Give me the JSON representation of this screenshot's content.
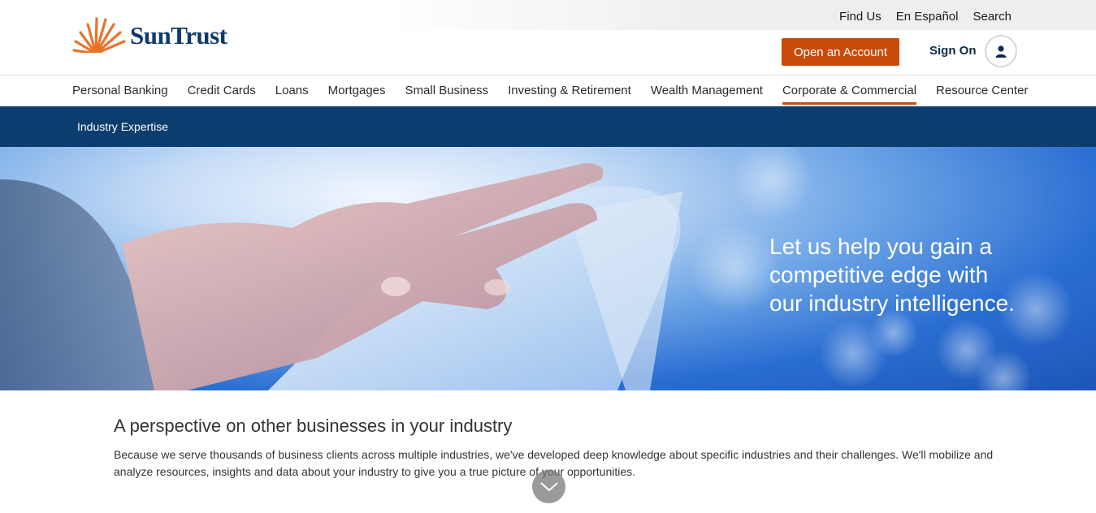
{
  "utility_nav": {
    "find_us": "Find Us",
    "espanol": "En Español",
    "search": "Search"
  },
  "brand": {
    "name": "SunTrust",
    "primary_color": "#0d3a6e",
    "accent_color": "#c84b0c"
  },
  "header": {
    "open_account": "Open an Account",
    "sign_on": "Sign On",
    "avatar_icon": "user-icon"
  },
  "main_nav": {
    "items": [
      {
        "label": "Personal Banking"
      },
      {
        "label": "Credit Cards"
      },
      {
        "label": "Loans"
      },
      {
        "label": "Mortgages"
      },
      {
        "label": "Small Business"
      },
      {
        "label": "Investing & Retirement"
      },
      {
        "label": "Wealth Management"
      },
      {
        "label": "Corporate & Commercial",
        "active": true
      },
      {
        "label": "Resource Center"
      }
    ]
  },
  "sub_nav": {
    "label": "Industry Expertise",
    "bg_color": "#0b3d6e"
  },
  "hero": {
    "line1": "Let us help you gain a",
    "line2": "competitive edge with",
    "line3": "our industry intelligence."
  },
  "content": {
    "heading": "A perspective on other businesses in your industry",
    "body": "Because we serve thousands of business clients across multiple industries, we've developed deep knowledge about specific industries and their challenges. We'll mobilize and analyze resources, insights and data about your industry to give you a true picture of your opportunities."
  },
  "scroll_icon": "chevron-down-icon"
}
